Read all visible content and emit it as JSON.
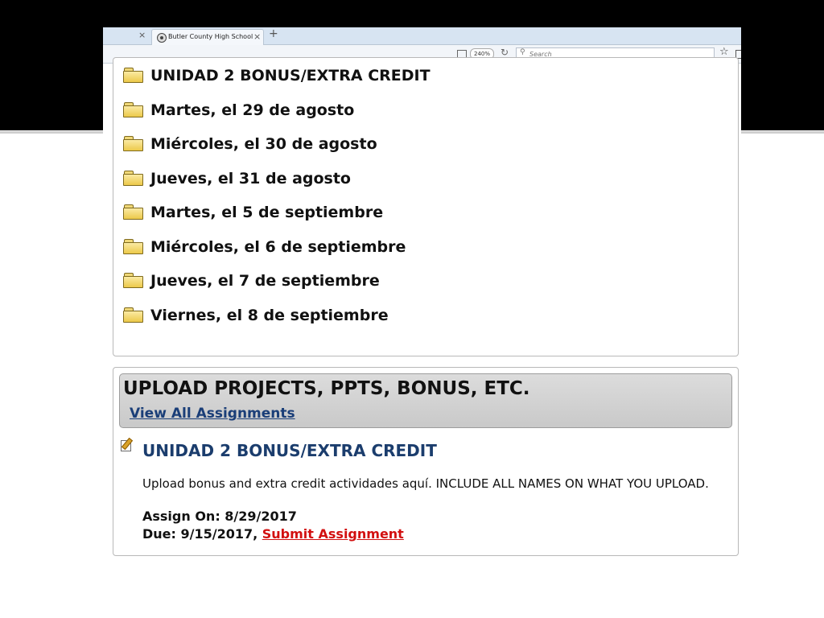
{
  "browser": {
    "tab_title": "Butler County High School",
    "zoom": "240%",
    "search_placeholder": "Search"
  },
  "folders": [
    "UNIDAD 2 BONUS/EXTRA CREDIT",
    "Martes, el 29 de agosto",
    "Miércoles, el 30 de agosto",
    "Jueves, el 31 de agosto",
    "Martes, el 5 de septiembre",
    "Miércoles, el 6 de septiembre",
    "Jueves, el 7 de septiembre",
    "Viernes, el 8 de septiembre"
  ],
  "assignments": {
    "header": "UPLOAD PROJECTS, PPTS, BONUS, ETC.",
    "view_all": "View All Assignments",
    "item": {
      "title": "UNIDAD 2 BONUS/EXTRA CREDIT",
      "description": "Upload bonus and extra credit actividades aquí. INCLUDE ALL NAMES ON WHAT YOU UPLOAD.",
      "assign_on": "Assign On: 8/29/2017",
      "due": "Due: 9/15/2017,",
      "submit": "Submit Assignment"
    }
  }
}
